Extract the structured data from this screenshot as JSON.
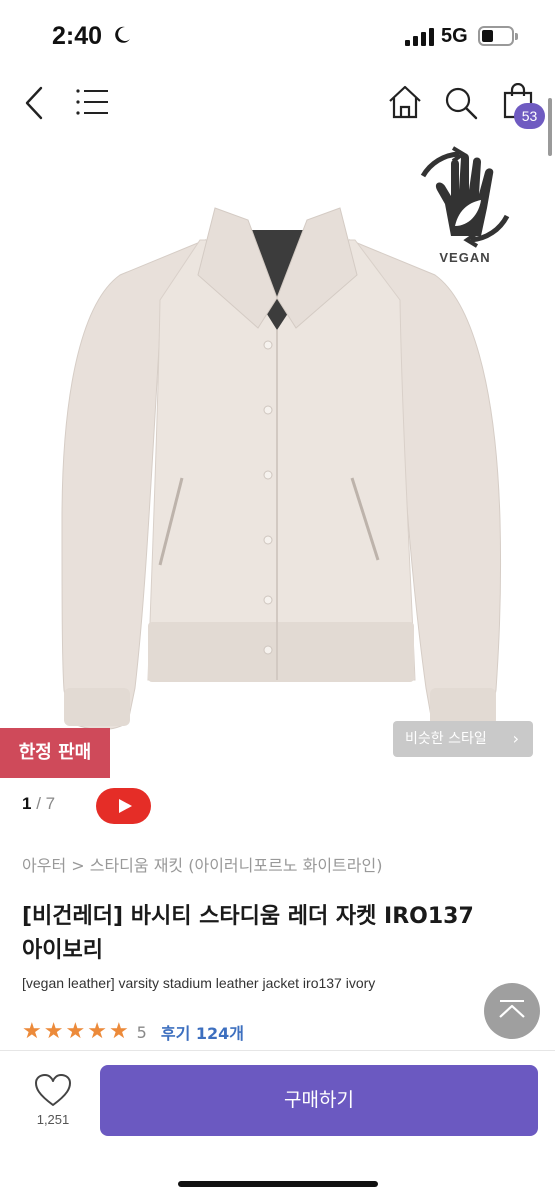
{
  "status_bar": {
    "time": "2:40",
    "network": "5G"
  },
  "header": {
    "cart_count": "53"
  },
  "gallery": {
    "vegan_label": "VEGAN",
    "limited_label": "한정 판매",
    "similar_style_label": "비슷한 스타일",
    "similar_style_chevron": "›",
    "current_index": "1",
    "separator": "/",
    "total": "7"
  },
  "product": {
    "breadcrumb": "아우터 > 스타디움 재킷 (아이러니포르노 화이트라인)",
    "title": "[비건레더] 바시티 스타디움 레더 자켓 IRO137 아이보리",
    "subtitle": "[vegan leather] varsity stadium leather jacket iro137 ivory",
    "rating_stars": 5,
    "rating_score": "5",
    "review_label": "후기 124개"
  },
  "bottom_bar": {
    "like_count": "1,251",
    "buy_label": "구매하기"
  },
  "colors": {
    "accent": "#6b59c1",
    "limited": "#cf4a5a",
    "star": "#ec8a3a",
    "review_link": "#3d6fbf",
    "video": "#e52d27"
  },
  "icons": [
    "back-icon",
    "menu-icon",
    "home-icon",
    "search-icon",
    "cart-icon",
    "vegan-hand-icon",
    "play-icon",
    "star-icon",
    "chevron-up-icon",
    "heart-icon"
  ]
}
